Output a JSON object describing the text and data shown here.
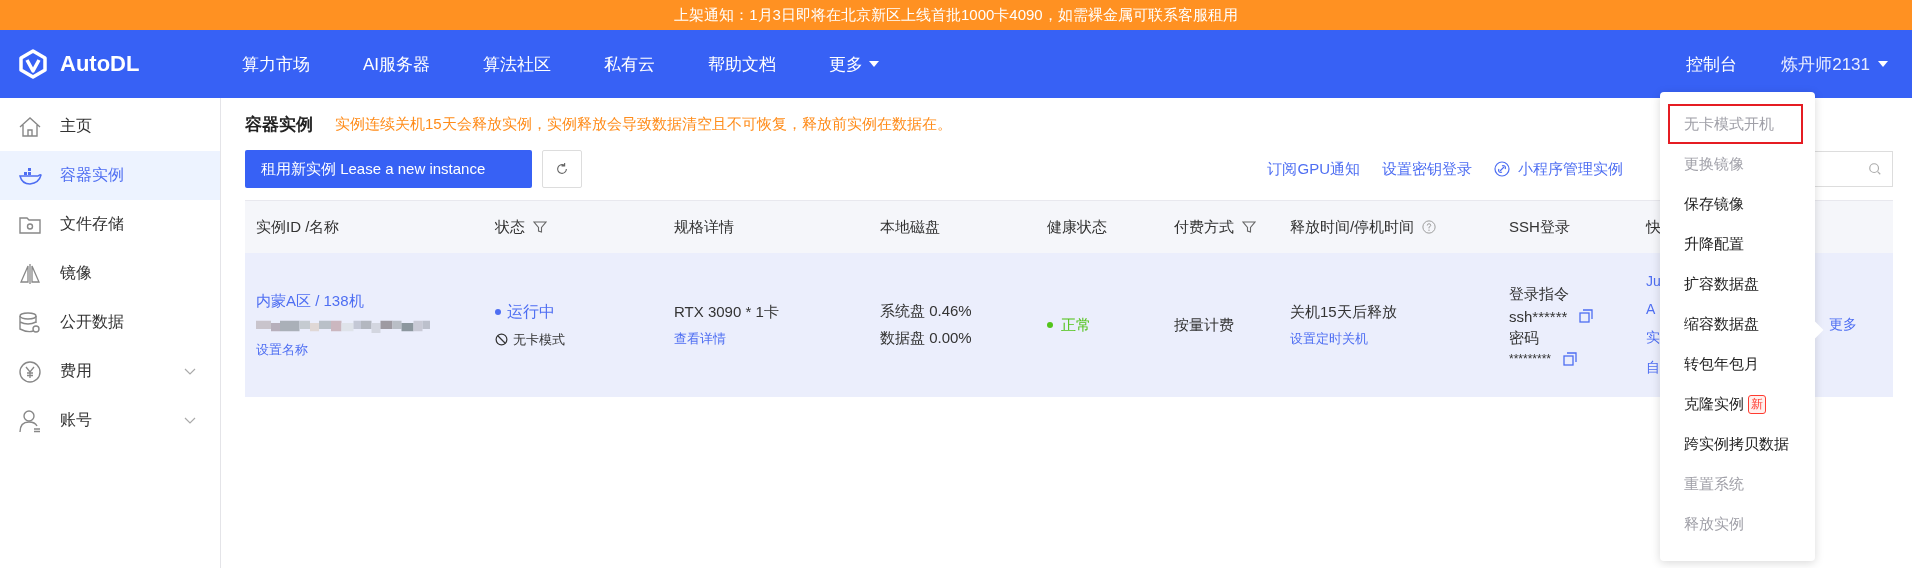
{
  "banner": {
    "text": "上架通知：1月3日即将在北京新区上线首批1000卡4090，如需裸金属可联系客服租用"
  },
  "nav": {
    "logo": "AutoDL",
    "items": [
      {
        "label": "算力市场",
        "dropdown": false
      },
      {
        "label": "AI服务器",
        "dropdown": false
      },
      {
        "label": "算法社区",
        "dropdown": false
      },
      {
        "label": "私有云",
        "dropdown": false
      },
      {
        "label": "帮助文档",
        "dropdown": false
      },
      {
        "label": "更多",
        "dropdown": true
      }
    ],
    "console": "控制台",
    "user": "炼丹师2131"
  },
  "sidebar": {
    "items": [
      {
        "kind": "home",
        "label": "主页",
        "selected": false
      },
      {
        "kind": "container",
        "label": "容器实例",
        "selected": true
      },
      {
        "kind": "storage",
        "label": "文件存储",
        "selected": false
      },
      {
        "kind": "image",
        "label": "镜像",
        "selected": false
      },
      {
        "kind": "data",
        "label": "公开数据",
        "selected": false
      },
      {
        "kind": "fee",
        "label": "费用",
        "selected": false,
        "expanded": false
      },
      {
        "kind": "account",
        "label": "账号",
        "selected": false,
        "expanded": false
      }
    ]
  },
  "page": {
    "title": "容器实例",
    "notice": "实例连续关机15天会释放实例，实例释放会导致数据清空且不可恢复，释放前实例在数据在。",
    "new_button": {
      "bold": "租用新实例",
      "rest": "Lease a new instance"
    },
    "links": [
      "订阅GPU通知",
      "设置密钥登录",
      "小程序管理实例"
    ]
  },
  "table": {
    "columns": [
      {
        "label": "实例ID /名称",
        "filter": false,
        "help": false
      },
      {
        "label": "状态",
        "filter": true,
        "help": false
      },
      {
        "label": "规格详情",
        "filter": false,
        "help": false
      },
      {
        "label": "本地磁盘",
        "filter": false,
        "help": false
      },
      {
        "label": "健康状态",
        "filter": false,
        "help": false
      },
      {
        "label": "付费方式",
        "filter": true,
        "help": false
      },
      {
        "label": "释放时间/停机时间",
        "filter": false,
        "help": true
      },
      {
        "label": "SSH登录",
        "filter": false,
        "help": false
      },
      {
        "label": "快"
      }
    ],
    "rows": [
      {
        "name": "内蒙A区 / 138机",
        "rename": "设置名称",
        "status": "运行中",
        "mode": "无卡模式",
        "spec": "RTX 3090 * 1卡",
        "spec_link": "查看详情",
        "disks": [
          "系统盘 0.46%",
          "数据盘 0.00%"
        ],
        "health": "正常",
        "billing": "按量计费",
        "release": "关机15天后释放",
        "release_link": "设置定时关机",
        "ssh_label": "登录指令",
        "ssh_cmd": "ssh******",
        "pwd_label": "密码",
        "pwd": "*********",
        "quick": [
          "Ju",
          "A",
          "实",
          "自"
        ],
        "more": "更多"
      }
    ]
  },
  "menu": {
    "items": [
      {
        "label": "无卡模式开机",
        "disabled": true,
        "highlighted": true
      },
      {
        "label": "更换镜像",
        "disabled": true,
        "highlighted": false
      },
      {
        "label": "保存镜像",
        "disabled": false,
        "highlighted": false
      },
      {
        "label": "升降配置",
        "disabled": false,
        "highlighted": false
      },
      {
        "label": "扩容数据盘",
        "disabled": false,
        "highlighted": false
      },
      {
        "label": "缩容数据盘",
        "disabled": false,
        "highlighted": false
      },
      {
        "label": "转包年包月",
        "disabled": false,
        "highlighted": false
      },
      {
        "label": "克隆实例",
        "disabled": false,
        "highlighted": false,
        "badge": "新"
      },
      {
        "label": "跨实例拷贝数据",
        "disabled": false,
        "highlighted": false
      },
      {
        "label": "重置系统",
        "disabled": true,
        "highlighted": false
      },
      {
        "label": "释放实例",
        "disabled": true,
        "highlighted": false
      }
    ]
  }
}
